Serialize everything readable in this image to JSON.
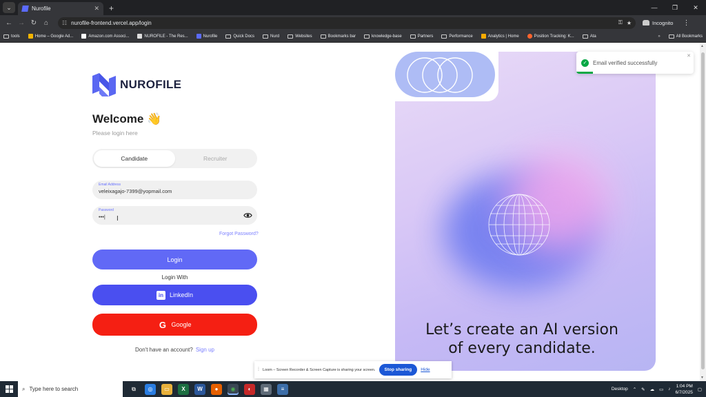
{
  "browser": {
    "tab_title": "Nurofile",
    "url": "nurofile-frontend.vercel.app/login",
    "incognito_label": "Incognito",
    "bookmarks": [
      "tools",
      "Home – Google Ad...",
      "Amazon.com Associ...",
      "NUROFILE - The Res...",
      "Nurofile",
      "Quick Docs",
      "Nurd",
      "Websites",
      "Bookmarks bar",
      "knowledge-base",
      "Partners",
      "Performance",
      "Analytics | Home",
      "Position Tracking: K...",
      "Ata"
    ],
    "all_bookmarks": "All Bookmarks"
  },
  "login": {
    "brand": "NUROFILE",
    "welcome": "Welcome 👋",
    "subtitle": "Please login here",
    "tabs": {
      "candidate": "Candidate",
      "recruiter": "Recruiter"
    },
    "email_label": "Email Address",
    "email_value": "veleixagajo-7399@yopmail.com",
    "password_label": "Password",
    "password_value": "•••|",
    "forgot": "Forgot Password?",
    "login_button": "Login",
    "login_with": "Login With",
    "linkedin_button": "LinkedIn",
    "google_button": "Google",
    "no_account": "Don't have an account?",
    "signup": "Sign up"
  },
  "promo": {
    "tagline_line1": "Let’s create an AI version",
    "tagline_line2": "of every candidate."
  },
  "toast": {
    "message": "Email verified successfully",
    "progress": 0.14
  },
  "loom": {
    "message": "Loom – Screen Recorder & Screen Capture is sharing your screen.",
    "stop": "Stop sharing",
    "hide": "Hide"
  },
  "taskbar": {
    "search_placeholder": "Type here to search",
    "desktop_label": "Desktop",
    "time": "1:04 PM",
    "date": "6/7/2025"
  },
  "colors": {
    "primary": "#6169f6",
    "linkedin": "#4a4ff0",
    "google": "#f51f13",
    "success": "#07a845"
  }
}
